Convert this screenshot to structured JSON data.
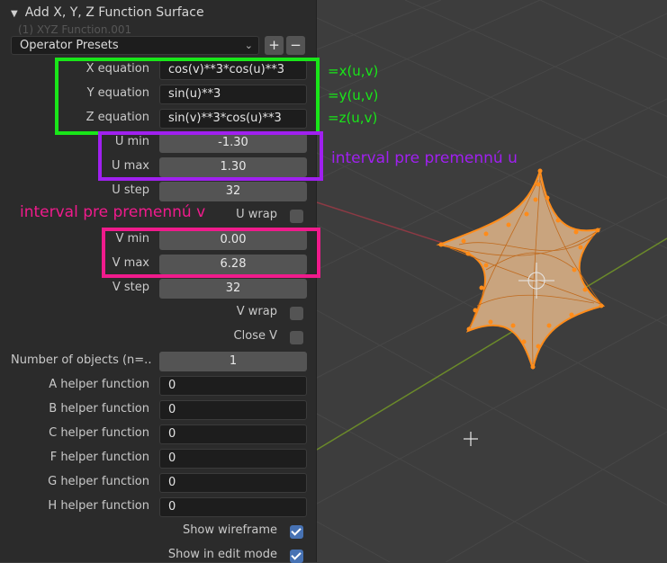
{
  "panel": {
    "title": "Add X, Y, Z Function Surface",
    "ghost_text": "(1) XYZ Function.001",
    "presets": {
      "label": "Operator Presets",
      "add_symbol": "+",
      "remove_symbol": "−"
    },
    "fields": [
      {
        "label": "X equation",
        "value": "cos(v)**3*cos(u)**3",
        "kind": "text"
      },
      {
        "label": "Y equation",
        "value": "sin(u)**3",
        "kind": "text"
      },
      {
        "label": "Z equation",
        "value": "sin(v)**3*cos(u)**3",
        "kind": "text"
      },
      {
        "label": "U min",
        "value": "-1.30",
        "kind": "number"
      },
      {
        "label": "U max",
        "value": "1.30",
        "kind": "number"
      },
      {
        "label": "U step",
        "value": "32",
        "kind": "number"
      },
      {
        "label": "V min",
        "value": "0.00",
        "kind": "number"
      },
      {
        "label": "V max",
        "value": "6.28",
        "kind": "number"
      },
      {
        "label": "V step",
        "value": "32",
        "kind": "number"
      },
      {
        "label": "Number of objects (n=..",
        "value": "1",
        "kind": "number"
      },
      {
        "label": "A helper function",
        "value": "0",
        "kind": "text"
      },
      {
        "label": "B helper function",
        "value": "0",
        "kind": "text"
      },
      {
        "label": "C helper function",
        "value": "0",
        "kind": "text"
      },
      {
        "label": "F helper function",
        "value": "0",
        "kind": "text"
      },
      {
        "label": "G helper function",
        "value": "0",
        "kind": "text"
      },
      {
        "label": "H helper function",
        "value": "0",
        "kind": "text"
      }
    ],
    "checkboxes": [
      {
        "label": "U wrap",
        "checked": false
      },
      {
        "label": "V wrap",
        "checked": false
      },
      {
        "label": "Close V",
        "checked": false
      },
      {
        "label": "Show wireframe",
        "checked": true
      },
      {
        "label": "Show in edit mode",
        "checked": true
      }
    ]
  },
  "annotations": {
    "x_of_uv": "=x(u,v)",
    "y_of_uv": "=y(u,v)",
    "z_of_uv": "=z(u,v)",
    "u_interval": "interval pre premennú u",
    "v_interval": "interval pre premennú v",
    "colors": {
      "green": "#19e619",
      "purple": "#a020f0",
      "pink": "#f01b8c"
    }
  },
  "viewport": {
    "mesh_color": "#ff8c1a",
    "surface_color": "#c9a47e",
    "grid_color": "#474747",
    "x_axis_color": "#8c3a44",
    "y_axis_color": "#6b8a2a"
  }
}
